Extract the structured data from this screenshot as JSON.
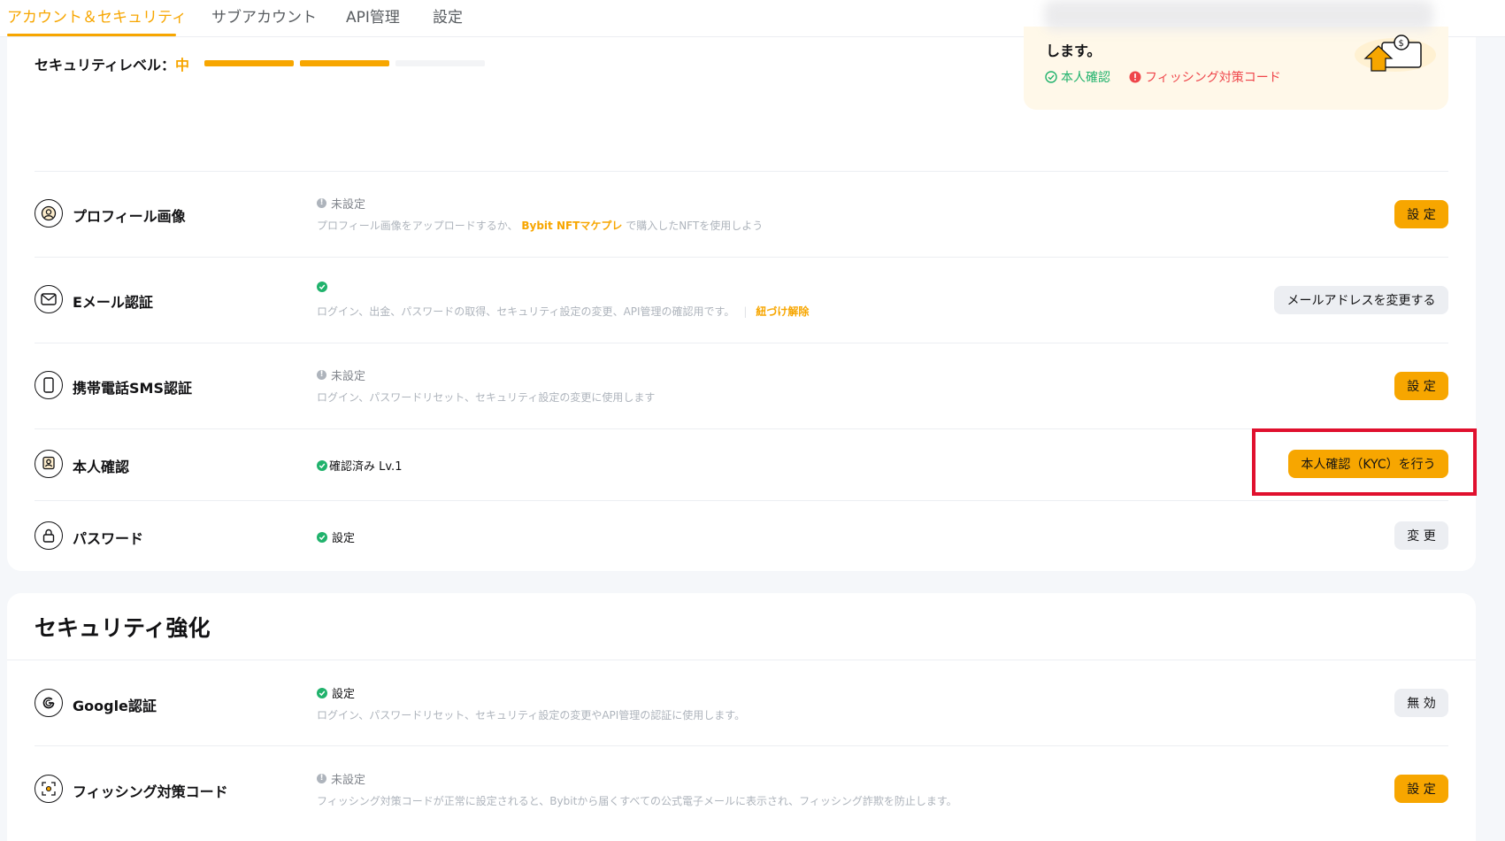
{
  "tabs": [
    {
      "label": "アカウント＆セキュリティ"
    },
    {
      "label": "サブアカウント"
    },
    {
      "label": "API管理"
    },
    {
      "label": "設定"
    }
  ],
  "security_level": {
    "label": "セキュリティレベル：",
    "value": "中",
    "segments_filled": 2,
    "segments_total": 3
  },
  "promo": {
    "text": "します。",
    "kyc_label": "本人確認",
    "phishing_label": "フィッシング対策コード"
  },
  "rows": [
    {
      "title": "プロフィール画像",
      "status": "未設定",
      "desc_before": "プロフィール画像をアップロードするか、",
      "desc_link": "Bybit NFTマケプレ",
      "desc_after": "で購入したNFTを使用しよう",
      "button": "設 定"
    },
    {
      "title": "Eメール認証",
      "desc": "ログイン、出金、パスワードの取得、セキュリティ設定の変更、API管理の確認用です。",
      "desc_link": "紐づけ解除",
      "button": "メールアドレスを変更する"
    },
    {
      "title": "携帯電話SMS認証",
      "status": "未設定",
      "desc": "ログイン、パスワードリセット、セキュリティ設定の変更に使用します",
      "button": "設 定"
    },
    {
      "title": "本人確認",
      "status": "確認済み Lv.1",
      "button": "本人確認（KYC）を行う"
    },
    {
      "title": "パスワード",
      "status": "設定",
      "button": "変 更"
    }
  ],
  "enhanced": {
    "title": "セキュリティ強化",
    "rows": [
      {
        "title": "Google認証",
        "status": "設定",
        "desc": "ログイン、パスワードリセット、セキュリティ設定の変更やAPI管理の認証に使用します。",
        "button": "無 効"
      },
      {
        "title": "フィッシング対策コード",
        "status": "未設定",
        "desc": "フィッシング対策コードが正常に設定されると、Bybitから届くすべての公式電子メールに表示され、フィッシング詐欺を防止します。",
        "button": "設 定"
      }
    ]
  },
  "colors": {
    "accent": "#f7a600",
    "success": "#20b26c",
    "danger": "#ef454a",
    "highlight": "#e0102e"
  }
}
